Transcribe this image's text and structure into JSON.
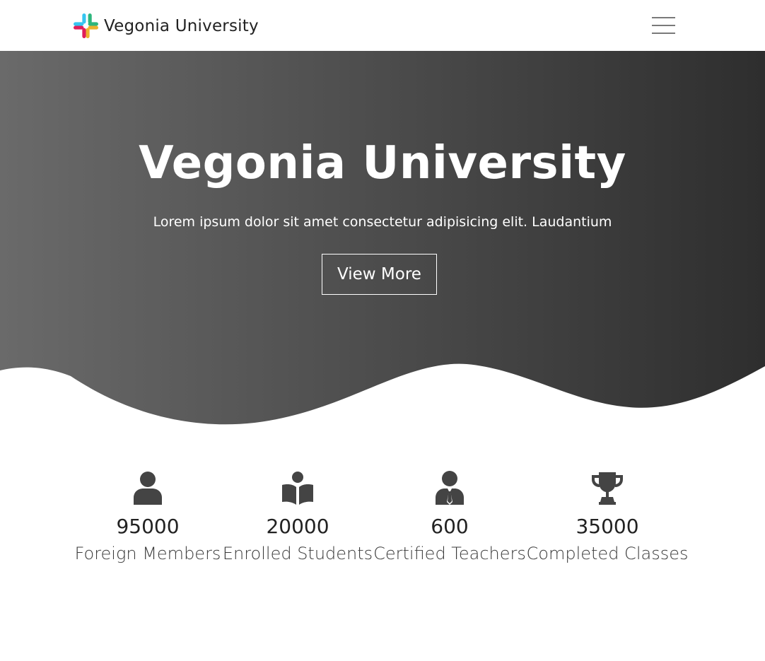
{
  "header": {
    "brand_name": "Vegonia University",
    "logo_icon": "slack-style-hash-logo-icon",
    "menu_icon": "hamburger-menu-icon"
  },
  "hero": {
    "title": "Vegonia University",
    "subtitle": "Lorem ipsum dolor sit amet consectetur adipisicing elit. Laudantium",
    "button_label": "View More",
    "gradient_colors": [
      "#6a6a6a",
      "#2e2e2e"
    ]
  },
  "stats": [
    {
      "icon": "user-icon",
      "value": "95000",
      "label": "Foreign Members"
    },
    {
      "icon": "book-reader-icon",
      "value": "20000",
      "label": "Enrolled Students"
    },
    {
      "icon": "teacher-icon",
      "value": "600",
      "label": "Certified Teachers"
    },
    {
      "icon": "trophy-icon",
      "value": "35000",
      "label": "Completed Classes"
    }
  ],
  "colors": {
    "icon": "#444444",
    "text": "#222222"
  }
}
